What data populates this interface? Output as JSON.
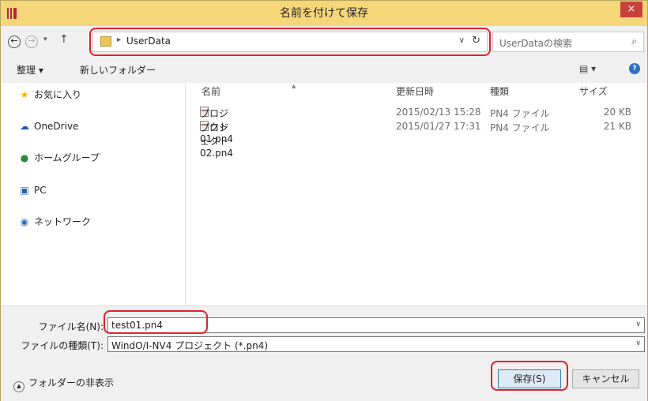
{
  "window": {
    "title": "名前を付けて保存",
    "close_label": "×"
  },
  "nav": {
    "back": "←",
    "forward": "→",
    "dropdown": "▾",
    "up": "↑"
  },
  "address": {
    "separator": "▸",
    "path": "UserData",
    "dropdown": "∨",
    "refresh": "↻"
  },
  "search": {
    "placeholder": "UserDataの検索",
    "icon": "⌕"
  },
  "toolbar": {
    "organize": "整理 ▾",
    "new_folder": "新しいフォルダー",
    "view": "▤ ▾",
    "help": "?"
  },
  "sidebar": {
    "items": [
      {
        "label": "お気に入り",
        "icon": "star-icon",
        "glyph": "★",
        "color": "#f0b400"
      },
      {
        "label": "OneDrive",
        "icon": "cloud-icon",
        "glyph": "☁",
        "color": "#1e5cb3"
      },
      {
        "label": "ホームグループ",
        "icon": "homegroup-icon",
        "glyph": "●",
        "color": "#2e8b3e"
      },
      {
        "label": "PC",
        "icon": "computer-icon",
        "glyph": "▣",
        "color": "#2a5ea8"
      },
      {
        "label": "ネットワーク",
        "icon": "network-icon",
        "glyph": "◉",
        "color": "#2a6fb5"
      }
    ]
  },
  "files": {
    "columns": [
      "名前",
      "更新日時",
      "種類",
      "サイズ"
    ],
    "rows": [
      {
        "name": "プロジェクト01.pn4",
        "modified": "2015/02/13 15:28",
        "type": "PN4 ファイル",
        "size": "20 KB"
      },
      {
        "name": "プロジェクト02.pn4",
        "modified": "2015/01/27 17:31",
        "type": "PN4 ファイル",
        "size": "21 KB"
      }
    ]
  },
  "form": {
    "filename_label": "ファイル名(N):",
    "filename_value": "test01.pn4",
    "filetype_label": "ファイルの種類(T):",
    "filetype_value": "WindO/I-NV4 プロジェクト (*.pn4)",
    "dropdown": "∨"
  },
  "footer": {
    "hide_folders": "フォルダーの非表示",
    "hide_icon": "▲",
    "save": "保存(S)",
    "cancel": "キャンセル"
  },
  "colors": {
    "titlebar": "#f5d77a",
    "highlight": "#e0232a",
    "close": "#c7413b"
  }
}
